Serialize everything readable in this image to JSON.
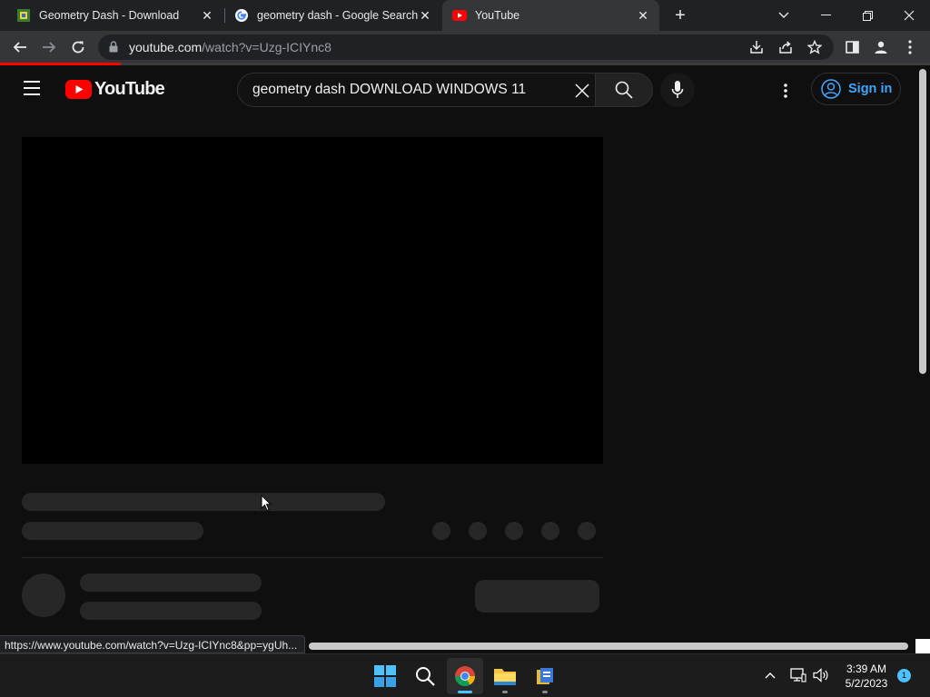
{
  "browser": {
    "tabs": [
      {
        "title": "Geometry Dash - Download",
        "favicon": "geometry-dash-favicon",
        "active": false
      },
      {
        "title": "geometry dash - Google Search",
        "favicon": "google-favicon",
        "active": false
      },
      {
        "title": "YouTube",
        "favicon": "youtube-favicon",
        "active": true
      }
    ],
    "close_glyph": "✕",
    "new_tab_glyph": "+",
    "url_domain": "youtube.com",
    "url_path": "/watch?v=Uzg-ICIYnc8",
    "load_progress": 0.13,
    "status_url": "https://www.youtube.com/watch?v=Uzg-ICIYnc8&pp=ygUh..."
  },
  "youtube": {
    "logo_text": "YouTube",
    "search_query": "geometry dash DOWNLOAD WINDOWS 11",
    "sign_in_label": "Sign in"
  },
  "taskbar": {
    "apps": [
      "windows-start",
      "search",
      "chrome",
      "file-explorer",
      "installer-app"
    ],
    "time": "3:39 AM",
    "date": "5/2/2023",
    "notification_count": "1"
  },
  "colors": {
    "brand_red": "#ff0000",
    "link_blue": "#3ea6ff",
    "page_bg": "#0f0f0f",
    "skeleton": "#272727",
    "accent": "#4cc2ff"
  }
}
